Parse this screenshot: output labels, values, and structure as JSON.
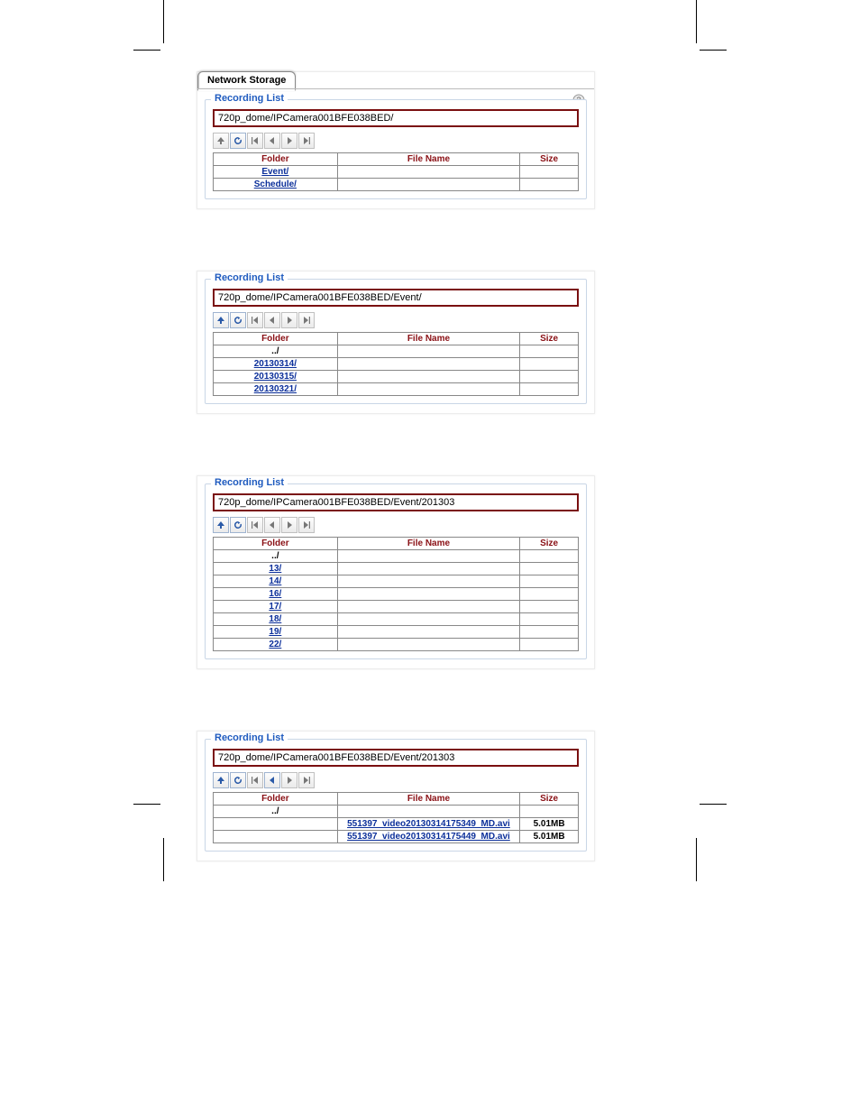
{
  "tab_label": "Network Storage",
  "legend": "Recording List",
  "headers": {
    "folder": "Folder",
    "filename": "File Name",
    "size": "Size"
  },
  "panel1": {
    "path": "720p_dome/IPCamera001BFE038BED/",
    "rows": [
      {
        "folder": "Event/",
        "filename": "",
        "size": ""
      },
      {
        "folder": "Schedule/",
        "filename": "",
        "size": ""
      }
    ]
  },
  "panel2": {
    "path": "720p_dome/IPCamera001BFE038BED/Event/",
    "rows": [
      {
        "folder": "../",
        "filename": "",
        "size": ""
      },
      {
        "folder": "20130314/",
        "filename": "",
        "size": ""
      },
      {
        "folder": "20130315/",
        "filename": "",
        "size": ""
      },
      {
        "folder": "20130321/",
        "filename": "",
        "size": ""
      }
    ]
  },
  "panel3": {
    "path": "720p_dome/IPCamera001BFE038BED/Event/201303",
    "rows": [
      {
        "folder": "../",
        "filename": "",
        "size": ""
      },
      {
        "folder": "13/",
        "filename": "",
        "size": ""
      },
      {
        "folder": "14/",
        "filename": "",
        "size": ""
      },
      {
        "folder": "16/",
        "filename": "",
        "size": ""
      },
      {
        "folder": "17/",
        "filename": "",
        "size": ""
      },
      {
        "folder": "18/",
        "filename": "",
        "size": ""
      },
      {
        "folder": "19/",
        "filename": "",
        "size": ""
      },
      {
        "folder": "22/",
        "filename": "",
        "size": ""
      }
    ]
  },
  "panel4": {
    "path": "720p_dome/IPCamera001BFE038BED/Event/201303",
    "rows": [
      {
        "folder": "../",
        "filename": "",
        "size": ""
      },
      {
        "folder": "",
        "filename": "551397_video20130314175349_MD.avi",
        "size": "5.01MB"
      },
      {
        "folder": "",
        "filename": "551397_video20130314175449_MD.avi",
        "size": "5.01MB"
      }
    ]
  }
}
